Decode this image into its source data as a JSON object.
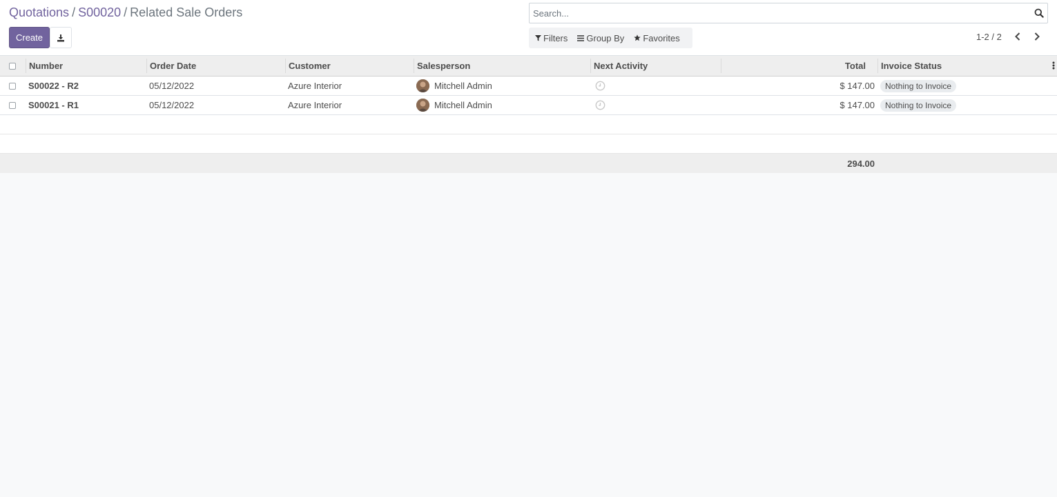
{
  "breadcrumb": {
    "items": [
      "Quotations",
      "S00020"
    ],
    "current": "Related Sale Orders",
    "separator": "/"
  },
  "toolbar": {
    "create_label": "Create",
    "download_icon": "download-icon"
  },
  "search": {
    "placeholder": "Search...",
    "value": ""
  },
  "filters": {
    "filters_label": "Filters",
    "group_by_label": "Group By",
    "favorites_label": "Favorites"
  },
  "pager": {
    "value": "1-2 / 2"
  },
  "table": {
    "headers": {
      "number": "Number",
      "order_date": "Order Date",
      "customer": "Customer",
      "salesperson": "Salesperson",
      "next_activity": "Next Activity",
      "total": "Total",
      "invoice_status": "Invoice Status"
    },
    "rows": [
      {
        "number": "S00022 - R2",
        "order_date": "05/12/2022",
        "customer": "Azure Interior",
        "salesperson": "Mitchell Admin",
        "next_activity": "clock-icon",
        "total": "$ 147.00",
        "invoice_status": "Nothing to Invoice"
      },
      {
        "number": "S00021 - R1",
        "order_date": "05/12/2022",
        "customer": "Azure Interior",
        "salesperson": "Mitchell Admin",
        "next_activity": "clock-icon",
        "total": "$ 147.00",
        "invoice_status": "Nothing to Invoice"
      }
    ],
    "footer_total": "294.00"
  },
  "colors": {
    "primary": "#71639e",
    "background": "#f8f9fa",
    "header_bg": "#eeeeee",
    "badge_bg": "#e9ecef"
  }
}
